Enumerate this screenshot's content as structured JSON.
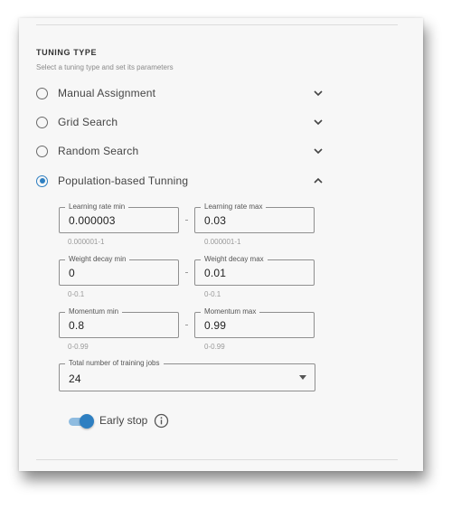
{
  "tuning": {
    "title": "TUNING TYPE",
    "subtitle": "Select a tuning type and set its parameters",
    "options": [
      {
        "label": "Manual Assignment",
        "selected": false,
        "expanded": false
      },
      {
        "label": "Grid Search",
        "selected": false,
        "expanded": false
      },
      {
        "label": "Random Search",
        "selected": false,
        "expanded": false
      },
      {
        "label": "Population-based Tunning",
        "selected": true,
        "expanded": true
      }
    ]
  },
  "params": {
    "learning_rate_min": {
      "label": "Learning rate min",
      "value": "0.000003",
      "hint": "0.000001-1"
    },
    "learning_rate_max": {
      "label": "Learning rate max",
      "value": "0.03",
      "hint": "0.000001-1"
    },
    "weight_decay_min": {
      "label": "Weight decay min",
      "value": "0",
      "hint": "0-0.1"
    },
    "weight_decay_max": {
      "label": "Weight decay max",
      "value": "0.01",
      "hint": "0-0.1"
    },
    "momentum_min": {
      "label": "Momentum min",
      "value": "0.8",
      "hint": "0-0.99"
    },
    "momentum_max": {
      "label": "Momentum max",
      "value": "0.99",
      "hint": "0-0.99"
    }
  },
  "jobs": {
    "label": "Total number of training jobs",
    "value": "24"
  },
  "early_stop": {
    "label": "Early stop",
    "enabled": true
  },
  "colors": {
    "accent": "#2e7fc1",
    "toggle_track": "#8fbce0",
    "panel_bg": "#f7f7f7"
  },
  "icons": {
    "expand": "chevron-down-icon",
    "collapse": "chevron-up-icon",
    "info": "info-icon",
    "dropdown": "caret-down-icon"
  }
}
